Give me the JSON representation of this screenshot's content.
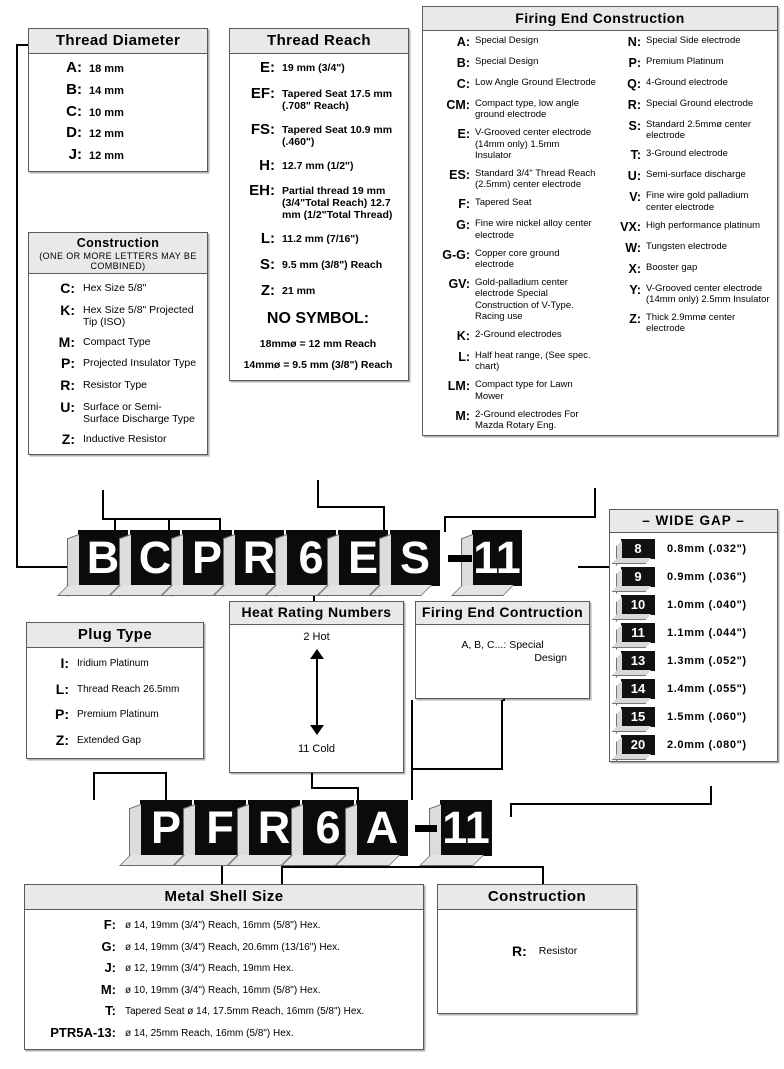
{
  "thread_diameter": {
    "title": "Thread Diameter",
    "items": [
      {
        "code": "A:",
        "desc": "18 mm"
      },
      {
        "code": "B:",
        "desc": "14 mm"
      },
      {
        "code": "C:",
        "desc": "10 mm"
      },
      {
        "code": "D:",
        "desc": "12 mm"
      },
      {
        "code": "J:",
        "desc": "12 mm"
      }
    ]
  },
  "construction_upper": {
    "title": "Construction",
    "subtitle": "(ONE OR MORE LETTERS MAY BE COMBINED)",
    "items": [
      {
        "code": "C:",
        "desc": "Hex Size 5/8\""
      },
      {
        "code": "K:",
        "desc": "Hex Size 5/8\" Projected Tip (ISO)"
      },
      {
        "code": "M:",
        "desc": "Compact Type"
      },
      {
        "code": "P:",
        "desc": "Projected Insulator Type"
      },
      {
        "code": "R:",
        "desc": "Resistor Type"
      },
      {
        "code": "U:",
        "desc": "Surface or Semi- Surface Discharge Type"
      },
      {
        "code": "Z:",
        "desc": "Inductive Resistor"
      }
    ]
  },
  "thread_reach": {
    "title": "Thread Reach",
    "items": [
      {
        "code": "E:",
        "desc": "19 mm (3/4\")"
      },
      {
        "code": "EF:",
        "desc": "Tapered Seat 17.5 mm (.708\" Reach)"
      },
      {
        "code": "FS:",
        "desc": "Tapered Seat 10.9 mm (.460\")"
      },
      {
        "code": "H:",
        "desc": "12.7 mm (1/2\")"
      },
      {
        "code": "EH:",
        "desc": "Partial thread 19 mm (3/4\"Total Reach) 12.7 mm (1/2\"Total Thread)"
      },
      {
        "code": "L:",
        "desc": "11.2 mm (7/16\")"
      },
      {
        "code": "S:",
        "desc": "9.5 mm (3/8\") Reach"
      },
      {
        "code": "Z:",
        "desc": "21 mm"
      }
    ],
    "no_symbol_title": "NO SYMBOL:",
    "no_symbol_lines": [
      "18mmø = 12 mm Reach",
      "14mmø = 9.5 mm (3/8\") Reach"
    ]
  },
  "firing_end_construction": {
    "title": "Firing End Construction",
    "left_items": [
      {
        "code": "A:",
        "desc": "Special Design"
      },
      {
        "code": "B:",
        "desc": "Special Design"
      },
      {
        "code": "C:",
        "desc": "Low Angle Ground Electrode"
      },
      {
        "code": "CM:",
        "desc": "Compact type, low angle ground electrode"
      },
      {
        "code": "E:",
        "desc": "V-Grooved center electrode (14mm only) 1.5mm Insulator"
      },
      {
        "code": "ES:",
        "desc": "Standard 3/4\" Thread Reach (2.5mm) center electrode"
      },
      {
        "code": "F:",
        "desc": "Tapered Seat"
      },
      {
        "code": "G:",
        "desc": "Fine wire nickel alloy center electrode"
      },
      {
        "code": "G-G:",
        "desc": "Copper core ground electrode"
      },
      {
        "code": "GV:",
        "desc": "Gold-palladium center electrode Special Construction of V-Type. Racing use"
      },
      {
        "code": "K:",
        "desc": "2-Ground electrodes"
      },
      {
        "code": "L:",
        "desc": "Half heat range, (See spec. chart)"
      },
      {
        "code": "LM:",
        "desc": "Compact type for Lawn Mower"
      },
      {
        "code": "M:",
        "desc": "2-Ground electrodes For Mazda Rotary Eng."
      }
    ],
    "right_items": [
      {
        "code": "N:",
        "desc": "Special Side electrode"
      },
      {
        "code": "P:",
        "desc": "Premium Platinum"
      },
      {
        "code": "Q:",
        "desc": "4-Ground electrode"
      },
      {
        "code": "R:",
        "desc": "Special Ground electrode"
      },
      {
        "code": "S:",
        "desc": "Standard 2.5mmø center electrode"
      },
      {
        "code": "T:",
        "desc": "3-Ground electrode"
      },
      {
        "code": "U:",
        "desc": "Semi-surface discharge"
      },
      {
        "code": "V:",
        "desc": "Fine wire gold palladium center electrode"
      },
      {
        "code": "VX:",
        "desc": "High performance platinum"
      },
      {
        "code": "W:",
        "desc": "Tungsten electrode"
      },
      {
        "code": "X:",
        "desc": "Booster gap"
      },
      {
        "code": "Y:",
        "desc": "V-Grooved center electrode (14mm only) 2.5mm Insulator"
      },
      {
        "code": "Z:",
        "desc": "Thick 2.9mmø center electrode"
      }
    ]
  },
  "wide_gap": {
    "title": "– WIDE GAP –",
    "items": [
      {
        "code": "8",
        "value": "0.8mm (.032\")"
      },
      {
        "code": "9",
        "value": "0.9mm (.036\")"
      },
      {
        "code": "10",
        "value": "1.0mm (.040\")"
      },
      {
        "code": "11",
        "value": "1.1mm (.044\")"
      },
      {
        "code": "13",
        "value": "1.3mm (.052\")"
      },
      {
        "code": "14",
        "value": "1.4mm (.055\")"
      },
      {
        "code": "15",
        "value": "1.5mm (.060\")"
      },
      {
        "code": "20",
        "value": "2.0mm (.080\")"
      }
    ]
  },
  "plug_type": {
    "title": "Plug Type",
    "items": [
      {
        "code": "I:",
        "desc": "Iridium Platinum"
      },
      {
        "code": "L:",
        "desc": "Thread Reach 26.5mm"
      },
      {
        "code": "P:",
        "desc": "Premium Platinum"
      },
      {
        "code": "Z:",
        "desc": "Extended Gap"
      }
    ]
  },
  "heat_rating": {
    "title": "Heat Rating Numbers",
    "top_label": "2 Hot",
    "bottom_label": "11 Cold"
  },
  "firing_end_small": {
    "title": "Firing End Contruction",
    "line1": "A, B, C...: Special",
    "line2": "Design"
  },
  "metal_shell": {
    "title": "Metal Shell Size",
    "items": [
      {
        "code": "F:",
        "desc": "ø 14, 19mm (3/4\") Reach, 16mm (5/8\") Hex."
      },
      {
        "code": "G:",
        "desc": "ø 14, 19mm (3/4\") Reach, 20.6mm (13/16\") Hex."
      },
      {
        "code": "J:",
        "desc": "ø 12, 19mm (3/4\") Reach, 19mm Hex."
      },
      {
        "code": "M:",
        "desc": "ø 10, 19mm (3/4\") Reach, 16mm (5/8\") Hex."
      },
      {
        "code": "T:",
        "desc": "Tapered Seat  ø 14, 17.5mm Reach, 16mm (5/8\") Hex."
      },
      {
        "code": "PTR5A-13:",
        "desc": "ø 14, 25mm Reach, 16mm (5/8\") Hex."
      }
    ]
  },
  "construction_lower": {
    "title": "Construction",
    "items": [
      {
        "code": "R:",
        "desc": "Resistor"
      }
    ]
  },
  "part_number_1": {
    "blocks": [
      "B",
      "C",
      "P",
      "R",
      "6",
      "E",
      "S"
    ],
    "suffix": "11",
    "separator": "–"
  },
  "part_number_2": {
    "blocks": [
      "P",
      "F",
      "R",
      "6",
      "A"
    ],
    "suffix": "11",
    "separator": "–"
  },
  "colors": {
    "block_fill": "#0b0b0b",
    "block_text": "#ffffff",
    "block_side": "#dcdcdc",
    "header_bg": "#e9e9e9",
    "border": "#5a5a5a"
  }
}
